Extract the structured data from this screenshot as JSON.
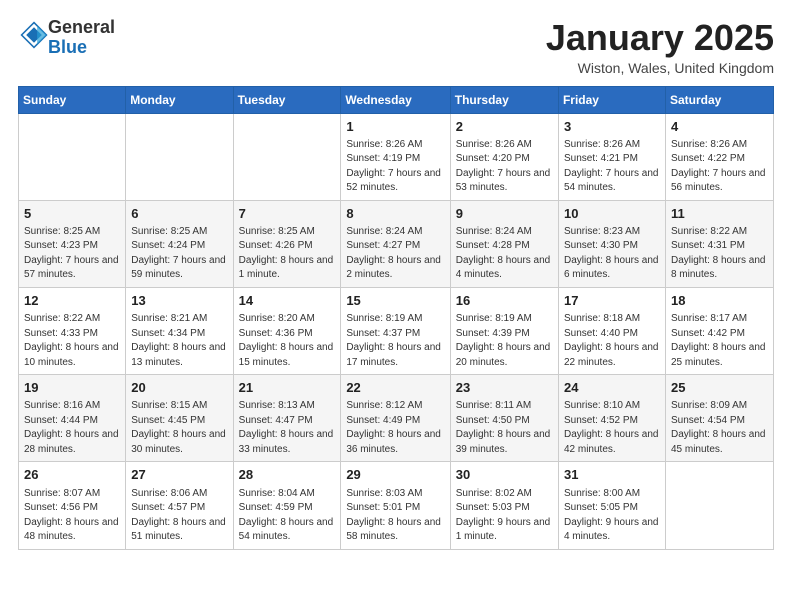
{
  "header": {
    "logo_general": "General",
    "logo_blue": "Blue",
    "month": "January 2025",
    "location": "Wiston, Wales, United Kingdom"
  },
  "weekdays": [
    "Sunday",
    "Monday",
    "Tuesday",
    "Wednesday",
    "Thursday",
    "Friday",
    "Saturday"
  ],
  "weeks": [
    [
      {
        "day": "",
        "info": ""
      },
      {
        "day": "",
        "info": ""
      },
      {
        "day": "",
        "info": ""
      },
      {
        "day": "1",
        "info": "Sunrise: 8:26 AM\nSunset: 4:19 PM\nDaylight: 7 hours and 52 minutes."
      },
      {
        "day": "2",
        "info": "Sunrise: 8:26 AM\nSunset: 4:20 PM\nDaylight: 7 hours and 53 minutes."
      },
      {
        "day": "3",
        "info": "Sunrise: 8:26 AM\nSunset: 4:21 PM\nDaylight: 7 hours and 54 minutes."
      },
      {
        "day": "4",
        "info": "Sunrise: 8:26 AM\nSunset: 4:22 PM\nDaylight: 7 hours and 56 minutes."
      }
    ],
    [
      {
        "day": "5",
        "info": "Sunrise: 8:25 AM\nSunset: 4:23 PM\nDaylight: 7 hours and 57 minutes."
      },
      {
        "day": "6",
        "info": "Sunrise: 8:25 AM\nSunset: 4:24 PM\nDaylight: 7 hours and 59 minutes."
      },
      {
        "day": "7",
        "info": "Sunrise: 8:25 AM\nSunset: 4:26 PM\nDaylight: 8 hours and 1 minute."
      },
      {
        "day": "8",
        "info": "Sunrise: 8:24 AM\nSunset: 4:27 PM\nDaylight: 8 hours and 2 minutes."
      },
      {
        "day": "9",
        "info": "Sunrise: 8:24 AM\nSunset: 4:28 PM\nDaylight: 8 hours and 4 minutes."
      },
      {
        "day": "10",
        "info": "Sunrise: 8:23 AM\nSunset: 4:30 PM\nDaylight: 8 hours and 6 minutes."
      },
      {
        "day": "11",
        "info": "Sunrise: 8:22 AM\nSunset: 4:31 PM\nDaylight: 8 hours and 8 minutes."
      }
    ],
    [
      {
        "day": "12",
        "info": "Sunrise: 8:22 AM\nSunset: 4:33 PM\nDaylight: 8 hours and 10 minutes."
      },
      {
        "day": "13",
        "info": "Sunrise: 8:21 AM\nSunset: 4:34 PM\nDaylight: 8 hours and 13 minutes."
      },
      {
        "day": "14",
        "info": "Sunrise: 8:20 AM\nSunset: 4:36 PM\nDaylight: 8 hours and 15 minutes."
      },
      {
        "day": "15",
        "info": "Sunrise: 8:19 AM\nSunset: 4:37 PM\nDaylight: 8 hours and 17 minutes."
      },
      {
        "day": "16",
        "info": "Sunrise: 8:19 AM\nSunset: 4:39 PM\nDaylight: 8 hours and 20 minutes."
      },
      {
        "day": "17",
        "info": "Sunrise: 8:18 AM\nSunset: 4:40 PM\nDaylight: 8 hours and 22 minutes."
      },
      {
        "day": "18",
        "info": "Sunrise: 8:17 AM\nSunset: 4:42 PM\nDaylight: 8 hours and 25 minutes."
      }
    ],
    [
      {
        "day": "19",
        "info": "Sunrise: 8:16 AM\nSunset: 4:44 PM\nDaylight: 8 hours and 28 minutes."
      },
      {
        "day": "20",
        "info": "Sunrise: 8:15 AM\nSunset: 4:45 PM\nDaylight: 8 hours and 30 minutes."
      },
      {
        "day": "21",
        "info": "Sunrise: 8:13 AM\nSunset: 4:47 PM\nDaylight: 8 hours and 33 minutes."
      },
      {
        "day": "22",
        "info": "Sunrise: 8:12 AM\nSunset: 4:49 PM\nDaylight: 8 hours and 36 minutes."
      },
      {
        "day": "23",
        "info": "Sunrise: 8:11 AM\nSunset: 4:50 PM\nDaylight: 8 hours and 39 minutes."
      },
      {
        "day": "24",
        "info": "Sunrise: 8:10 AM\nSunset: 4:52 PM\nDaylight: 8 hours and 42 minutes."
      },
      {
        "day": "25",
        "info": "Sunrise: 8:09 AM\nSunset: 4:54 PM\nDaylight: 8 hours and 45 minutes."
      }
    ],
    [
      {
        "day": "26",
        "info": "Sunrise: 8:07 AM\nSunset: 4:56 PM\nDaylight: 8 hours and 48 minutes."
      },
      {
        "day": "27",
        "info": "Sunrise: 8:06 AM\nSunset: 4:57 PM\nDaylight: 8 hours and 51 minutes."
      },
      {
        "day": "28",
        "info": "Sunrise: 8:04 AM\nSunset: 4:59 PM\nDaylight: 8 hours and 54 minutes."
      },
      {
        "day": "29",
        "info": "Sunrise: 8:03 AM\nSunset: 5:01 PM\nDaylight: 8 hours and 58 minutes."
      },
      {
        "day": "30",
        "info": "Sunrise: 8:02 AM\nSunset: 5:03 PM\nDaylight: 9 hours and 1 minute."
      },
      {
        "day": "31",
        "info": "Sunrise: 8:00 AM\nSunset: 5:05 PM\nDaylight: 9 hours and 4 minutes."
      },
      {
        "day": "",
        "info": ""
      }
    ]
  ]
}
